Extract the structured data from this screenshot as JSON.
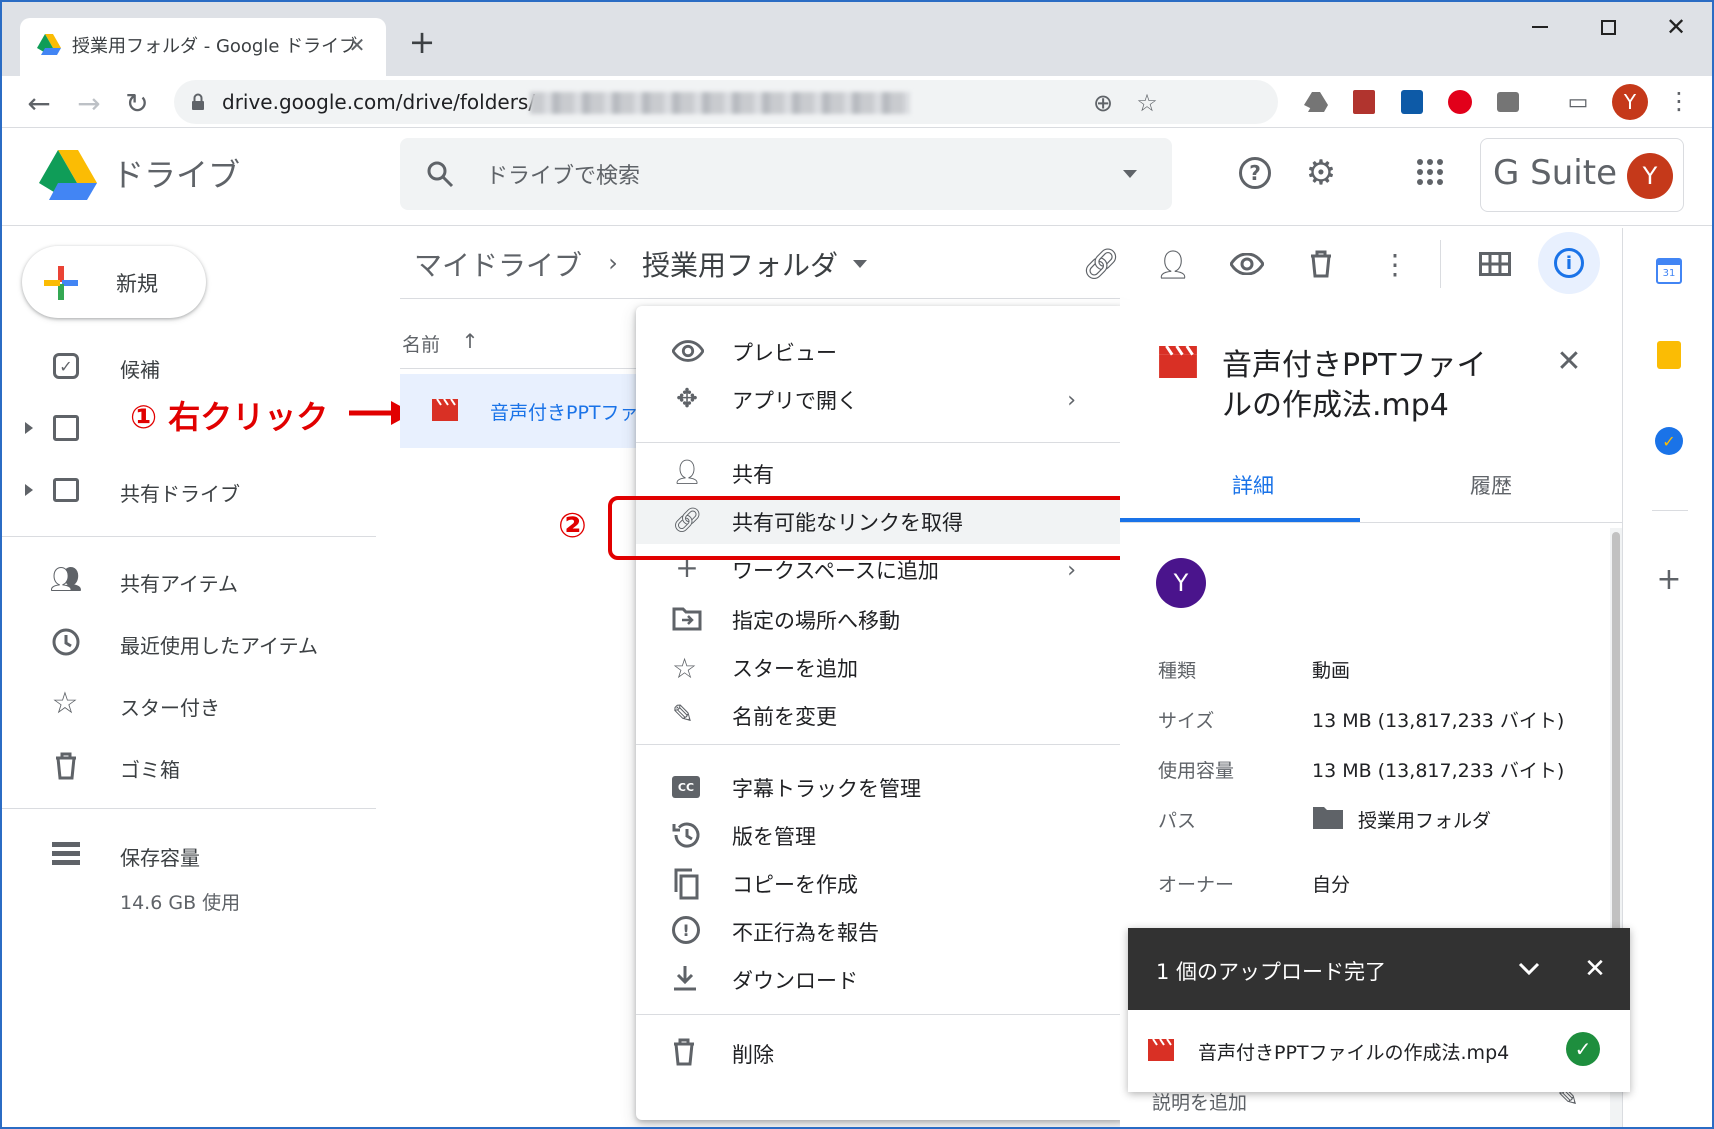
{
  "browser": {
    "tab_title": "授業用フォルダ - Google ドライブ",
    "url": "drive.google.com/drive/folders/",
    "profile_initial": "Y"
  },
  "drive": {
    "product_name": "ドライブ",
    "search_placeholder": "ドライブで検索",
    "gsuite_label": "G Suite",
    "avatar_initial": "Y"
  },
  "sidebar": {
    "new_label": "新規",
    "items": [
      {
        "label": "候補"
      },
      {
        "label": ""
      },
      {
        "label": "共有ドライブ"
      },
      {
        "label": "共有アイテム"
      },
      {
        "label": "最近使用したアイテム"
      },
      {
        "label": "スター付き"
      },
      {
        "label": "ゴミ箱"
      },
      {
        "label": "保存容量"
      }
    ],
    "storage_used": "14.6 GB 使用"
  },
  "breadcrumb": {
    "root": "マイドライブ",
    "current": "授業用フォルダ"
  },
  "file_list": {
    "sort_column": "名前",
    "file_name": "音声付きPPTファ"
  },
  "annotations": {
    "step1": "① 右クリック",
    "step2": "②"
  },
  "context_menu": {
    "items": [
      {
        "label": "プレビュー"
      },
      {
        "label": "アプリで開く"
      },
      {
        "label": "共有"
      },
      {
        "label": "共有可能なリンクを取得"
      },
      {
        "label": "ワークスペースに追加"
      },
      {
        "label": "指定の場所へ移動"
      },
      {
        "label": "スターを追加"
      },
      {
        "label": "名前を変更"
      },
      {
        "label": "字幕トラックを管理"
      },
      {
        "label": "版を管理"
      },
      {
        "label": "コピーを作成"
      },
      {
        "label": "不正行為を報告"
      },
      {
        "label": "ダウンロード"
      },
      {
        "label": "削除"
      }
    ]
  },
  "details": {
    "title_line1": "音声付きPPTファイ",
    "title_line2": "ルの作成法.mp4",
    "tab_details": "詳細",
    "tab_history": "履歴",
    "owner_initial": "Y",
    "rows": [
      {
        "key": "種類",
        "value": "動画"
      },
      {
        "key": "サイズ",
        "value": "13 MB (13,817,233 バイト)"
      },
      {
        "key": "使用容量",
        "value": "13 MB (13,817,233 バイト)"
      },
      {
        "key": "パス",
        "value": "授業用フォルダ"
      },
      {
        "key": "オーナー",
        "value": "自分"
      }
    ],
    "add_description": "説明を追加"
  },
  "upload_toast": {
    "title": "1 個のアップロード完了",
    "file_name": "音声付きPPTファイルの作成法.mp4"
  },
  "colors": {
    "accent_blue": "#1a73e8",
    "annotation_red": "#e10000",
    "video_icon_red": "#d93025",
    "success_green": "#1e8e3e"
  }
}
